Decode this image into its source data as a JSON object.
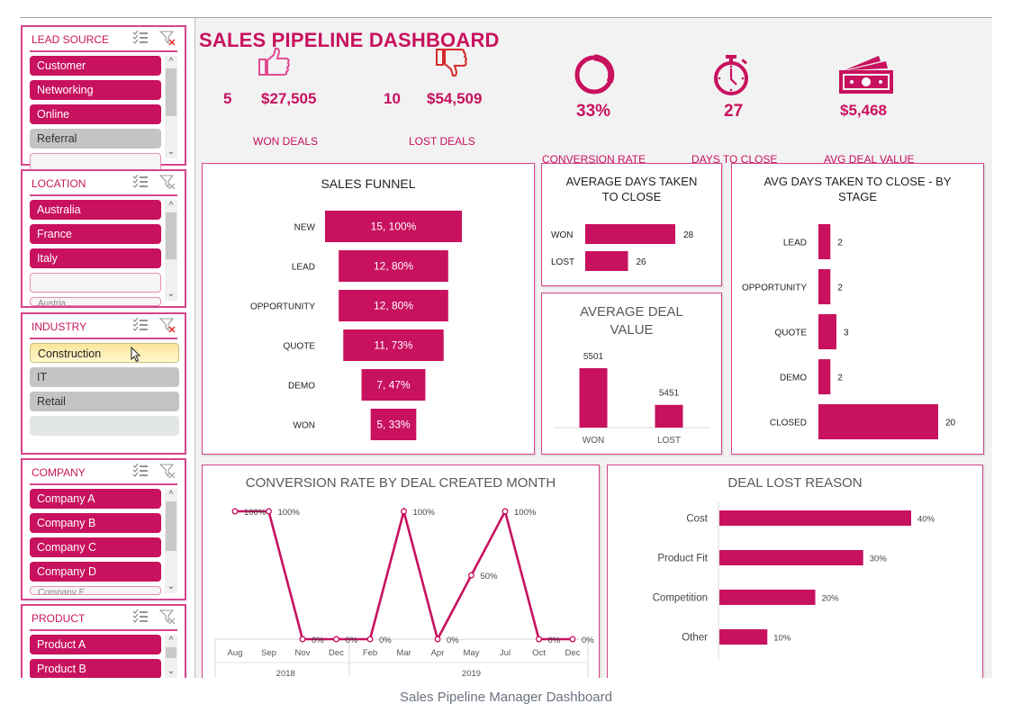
{
  "title": "SALES PIPELINE  DASHBOARD",
  "caption": "Sales Pipeline Manager Dashboard",
  "accent_color": "#c8115f",
  "slicers": [
    {
      "title": "LEAD SOURCE",
      "items": [
        {
          "label": "Customer",
          "state": "selected"
        },
        {
          "label": "Networking",
          "state": "selected"
        },
        {
          "label": "Online",
          "state": "selected"
        },
        {
          "label": "Referral",
          "state": "unselected"
        },
        {
          "label": "",
          "state": "empty"
        }
      ]
    },
    {
      "title": "LOCATION",
      "items": [
        {
          "label": "Australia",
          "state": "selected"
        },
        {
          "label": "France",
          "state": "selected"
        },
        {
          "label": "Italy",
          "state": "selected"
        },
        {
          "label": "",
          "state": "empty"
        },
        {
          "label": "Austria",
          "state": "cut"
        }
      ]
    },
    {
      "title": "INDUSTRY",
      "items": [
        {
          "label": "Construction",
          "state": "hover"
        },
        {
          "label": "IT",
          "state": "unselected"
        },
        {
          "label": "Retail",
          "state": "unselected"
        },
        {
          "label": "",
          "state": "ghost"
        }
      ]
    },
    {
      "title": "COMPANY",
      "items": [
        {
          "label": "Company A",
          "state": "selected"
        },
        {
          "label": "Company B",
          "state": "selected"
        },
        {
          "label": "Company C",
          "state": "selected"
        },
        {
          "label": "Company D",
          "state": "selected"
        },
        {
          "label": "Company E",
          "state": "cut"
        }
      ]
    },
    {
      "title": "PRODUCT",
      "items": [
        {
          "label": "Product A",
          "state": "selected"
        },
        {
          "label": "Product B",
          "state": "selected"
        }
      ]
    }
  ],
  "kpis": {
    "won": {
      "count": "5",
      "amount": "$27,505",
      "label": "WON DEALS",
      "icon": "thumbs-up-icon"
    },
    "lost": {
      "count": "10",
      "amount": "$54,509",
      "label": "LOST DEALS",
      "icon": "thumbs-down-icon"
    },
    "conversion": {
      "value": "33%",
      "label": "CONVERSION RATE",
      "icon": "donut-ring-icon"
    },
    "days": {
      "value": "27",
      "label": "DAYS TO CLOSE",
      "icon": "stopwatch-icon"
    },
    "avg_deal": {
      "value": "$5,468",
      "label": "AVG DEAL VALUE",
      "icon": "cash-icon"
    }
  },
  "chart_data": [
    {
      "id": "funnel",
      "type": "bar",
      "title": "SALES FUNNEL",
      "categories": [
        "NEW",
        "LEAD",
        "OPPORTUNITY",
        "QUOTE",
        "DEMO",
        "WON"
      ],
      "values": [
        15,
        12,
        12,
        11,
        7,
        5
      ],
      "data_labels": [
        "15, 100%",
        "12, 80%",
        "12, 80%",
        "11, 73%",
        "7, 47%",
        "5, 33%"
      ],
      "orientation": "funnel"
    },
    {
      "id": "avg_days",
      "type": "bar",
      "title": "AVERAGE DAYS TAKEN TO CLOSE",
      "title_lines": [
        "AVERAGE DAYS TAKEN",
        "TO CLOSE"
      ],
      "categories": [
        "WON",
        "LOST"
      ],
      "values": [
        28,
        26
      ],
      "orientation": "horizontal"
    },
    {
      "id": "avg_deal_value",
      "type": "bar",
      "title": "AVERAGE DEAL VALUE",
      "title_lines": [
        "AVERAGE DEAL",
        "VALUE"
      ],
      "categories": [
        "WON",
        "LOST"
      ],
      "values": [
        5501,
        5451
      ],
      "orientation": "vertical"
    },
    {
      "id": "days_by_stage",
      "type": "bar",
      "title": "AVG DAYS TAKEN TO CLOSE - BY STAGE",
      "title_lines": [
        "AVG DAYS TAKEN TO CLOSE - BY",
        "STAGE"
      ],
      "categories": [
        "LEAD",
        "OPPORTUNITY",
        "QUOTE",
        "DEMO",
        "CLOSED"
      ],
      "values": [
        2,
        2,
        3,
        2,
        20
      ],
      "orientation": "horizontal"
    },
    {
      "id": "conversion_by_month",
      "type": "line",
      "title": "CONVERSION RATE BY DEAL CREATED MONTH",
      "categories": [
        "Aug",
        "Sep",
        "Nov",
        "Dec",
        "Feb",
        "Mar",
        "Apr",
        "May",
        "Jul",
        "Oct",
        "Dec"
      ],
      "groups": [
        {
          "label": "2018",
          "count": 4
        },
        {
          "label": "2019",
          "count": 7
        }
      ],
      "values": [
        100,
        100,
        0,
        0,
        0,
        100,
        0,
        50,
        100,
        0,
        0
      ],
      "data_labels": [
        "100%",
        "100%",
        "0%",
        "0%",
        "0%",
        "100%",
        "0%",
        "50%",
        "100%",
        "0%",
        "0%"
      ],
      "ylim": [
        0,
        100
      ]
    },
    {
      "id": "lost_reason",
      "type": "bar",
      "title": "DEAL LOST REASON",
      "categories": [
        "Cost",
        "Product Fit",
        "Competition",
        "Other"
      ],
      "values": [
        40,
        30,
        20,
        10
      ],
      "data_labels": [
        "40%",
        "30%",
        "20%",
        "10%"
      ],
      "orientation": "horizontal"
    }
  ]
}
